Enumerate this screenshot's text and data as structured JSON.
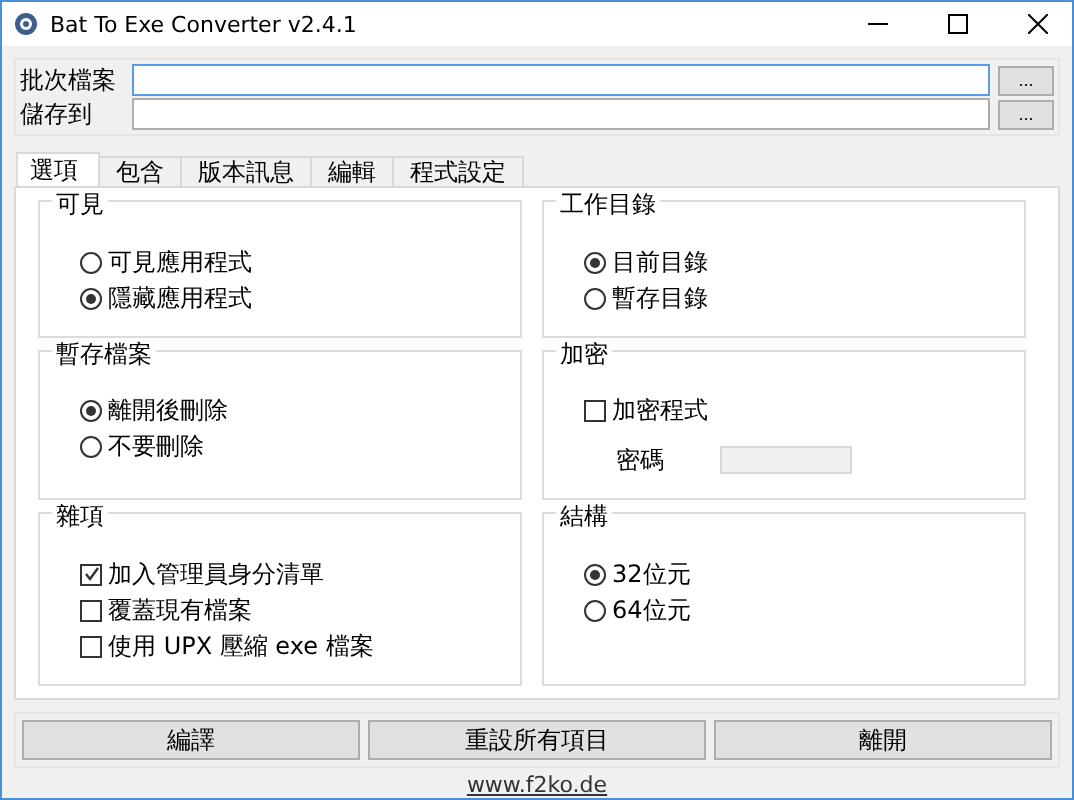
{
  "window": {
    "title": "Bat To Exe Converter v2.4.1"
  },
  "fields": [
    {
      "label": "批次檔案",
      "focused": true,
      "browse": "..."
    },
    {
      "label": "儲存到",
      "focused": false,
      "browse": "..."
    }
  ],
  "tabs": [
    {
      "label": "選項",
      "selected": true
    },
    {
      "label": "包含",
      "selected": false
    },
    {
      "label": "版本訊息",
      "selected": false
    },
    {
      "label": "編輯",
      "selected": false
    },
    {
      "label": "程式設定",
      "selected": false
    }
  ],
  "groups": [
    {
      "title": "可見",
      "items": [
        {
          "kind": "radio",
          "label": "可見應用程式",
          "selected": false
        },
        {
          "kind": "radio",
          "label": "隱藏應用程式",
          "selected": true
        }
      ]
    },
    {
      "title": "工作目錄",
      "items": [
        {
          "kind": "radio",
          "label": "目前目錄",
          "selected": true
        },
        {
          "kind": "radio",
          "label": "暫存目錄",
          "selected": false
        }
      ]
    },
    {
      "title": "暫存檔案",
      "items": [
        {
          "kind": "radio",
          "label": "離開後刪除",
          "selected": true
        },
        {
          "kind": "radio",
          "label": "不要刪除",
          "selected": false
        }
      ]
    },
    {
      "title": "加密",
      "items": [
        {
          "kind": "checkbox",
          "label": "加密程式",
          "checked": false
        },
        {
          "kind": "password",
          "label": "密碼",
          "disabled": true
        }
      ]
    },
    {
      "title": "雜項",
      "items": [
        {
          "kind": "checkbox",
          "label": "加入管理員身分清單",
          "checked": true
        },
        {
          "kind": "checkbox",
          "label": "覆蓋現有檔案",
          "checked": false
        },
        {
          "kind": "checkbox",
          "label": "使用 UPX 壓縮 exe 檔案",
          "checked": false
        }
      ]
    },
    {
      "title": "結構",
      "items": [
        {
          "kind": "radio",
          "label": "32位元",
          "selected": true
        },
        {
          "kind": "radio",
          "label": "64位元",
          "selected": false
        }
      ]
    }
  ],
  "buttons": [
    "編譯",
    "重設所有項目",
    "離開"
  ],
  "link": "www.f2ko.de"
}
